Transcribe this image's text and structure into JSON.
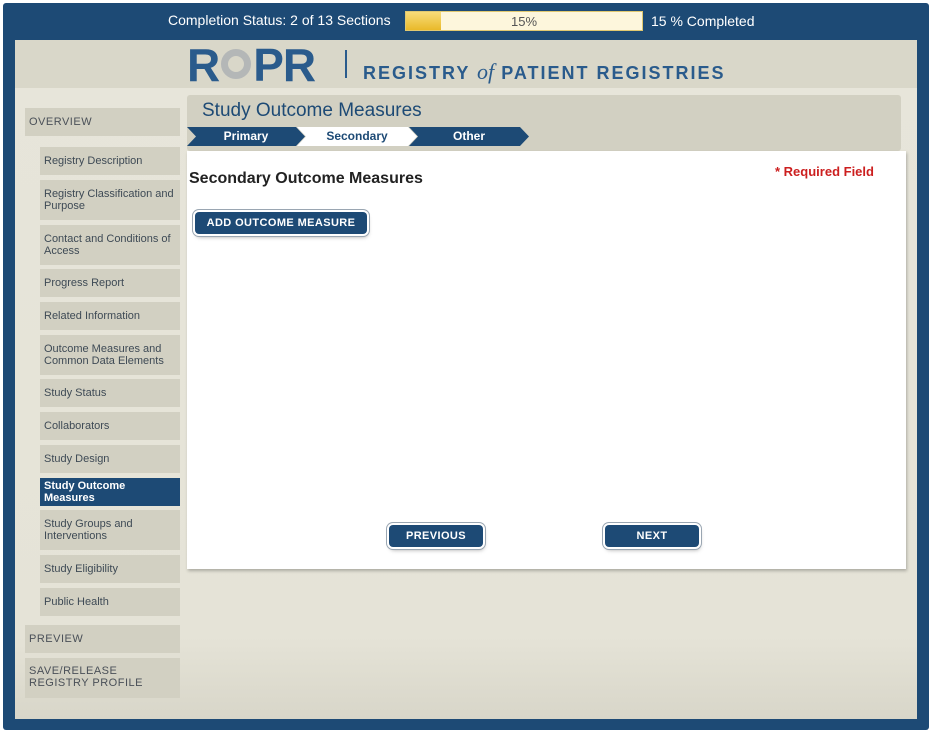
{
  "status": {
    "completion_text": "Completion Status: 2 of 13 Sections",
    "progress_percent": 15,
    "progress_label": "15%",
    "completed_text": "15 % Completed"
  },
  "logo": {
    "brand_left": "R",
    "brand_right": "PR",
    "tagline_left": "REGISTRY",
    "tagline_of": "of",
    "tagline_right": "PATIENT REGISTRIES"
  },
  "sidebar": {
    "overview": "OVERVIEW",
    "items": [
      "Registry Description",
      "Registry Classification and Purpose",
      "Contact and Conditions of Access",
      "Progress Report",
      "Related Information",
      "Outcome Measures and Common Data Elements",
      "Study Status",
      "Collaborators",
      "Study Design",
      "Study Outcome Measures",
      "Study Groups and Interventions",
      "Study Eligibility",
      "Public Health"
    ],
    "active_item": "Study Outcome Measures",
    "preview": "PREVIEW",
    "save_release": "SAVE/RELEASE REGISTRY PROFILE"
  },
  "main": {
    "page_title": "Study Outcome Measures",
    "steps": [
      "Primary",
      "Secondary",
      "Other"
    ],
    "active_step": "Secondary",
    "section_heading": "Secondary Outcome Measures",
    "required_note": "* Required Field",
    "add_button": "ADD OUTCOME MEASURE",
    "previous_button": "PREVIOUS",
    "next_button": "NEXT"
  },
  "colors": {
    "primary": "#1d4a75",
    "panel": "#d2d0c2",
    "required": "#cc1f1f"
  }
}
